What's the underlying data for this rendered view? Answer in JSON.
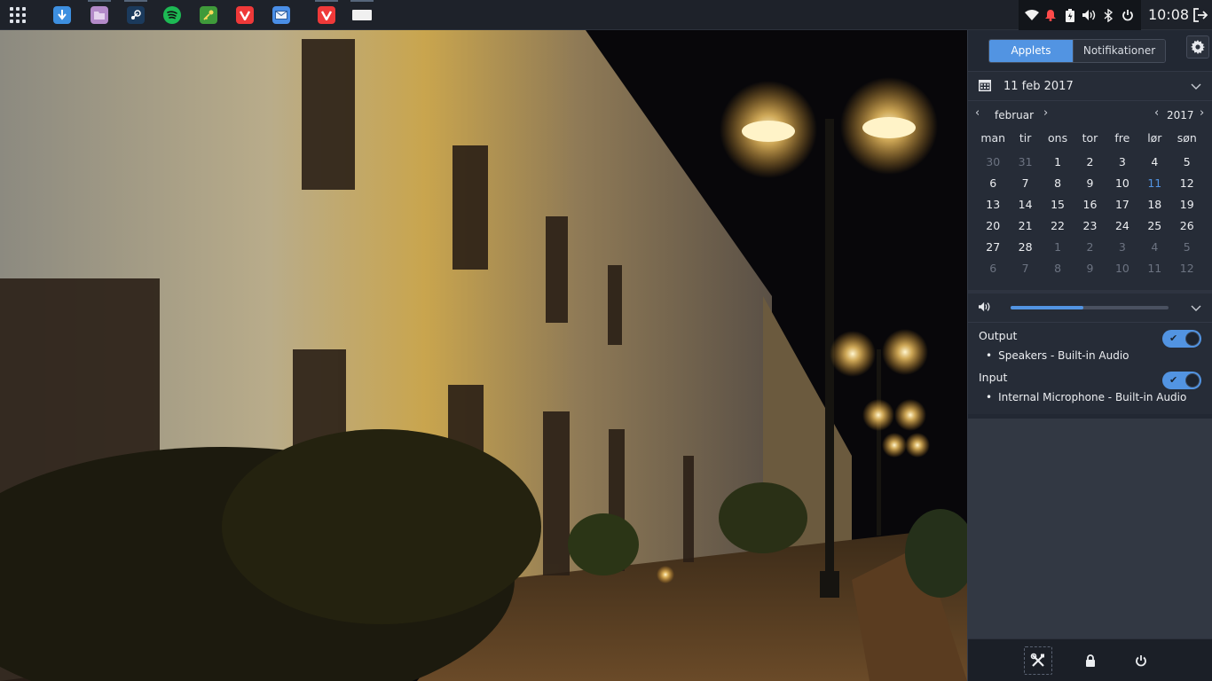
{
  "taskbar": {
    "launcher_icon": "app-grid-icon",
    "tasks": [
      {
        "name": "downloader",
        "icon": "download-arrow-icon",
        "color": "#3d8fe0"
      },
      {
        "name": "file-manager",
        "icon": "folder-icon",
        "color": "#b38ac9"
      },
      {
        "name": "steam",
        "icon": "steam-icon",
        "color": "#1b3a5c"
      },
      {
        "name": "spotify",
        "icon": "spotify-icon",
        "color": "#1db954"
      },
      {
        "name": "password-manager",
        "icon": "key-icon",
        "color": "#3f9a3a"
      },
      {
        "name": "vivaldi",
        "icon": "vivaldi-icon",
        "color": "#ef3939"
      },
      {
        "name": "mail",
        "icon": "envelope-icon",
        "color": "#4a8ee6"
      },
      {
        "name": "vivaldi-window",
        "icon": "vivaldi-icon",
        "color": "#ef3939"
      },
      {
        "name": "blank-window",
        "icon": "window-icon",
        "color": "#f0f0f0"
      }
    ],
    "tray_icons": [
      "wifi-icon",
      "notification-bell-icon",
      "battery-icon",
      "volume-icon",
      "bluetooth-icon",
      "power-icon"
    ],
    "clock": "10:08",
    "logout_icon": "logout-icon"
  },
  "raven": {
    "tabs": {
      "applets": "Applets",
      "notifications": "Notifikationer"
    },
    "settings_icon": "gear-icon",
    "calendar": {
      "header_date": "11 feb 2017",
      "month": "februar",
      "year": "2017",
      "prev": "‹",
      "next": "›",
      "weekdays": [
        "man",
        "tir",
        "ons",
        "tor",
        "fre",
        "lør",
        "søn"
      ],
      "weeks": [
        [
          {
            "d": "30",
            "m": "prev"
          },
          {
            "d": "31",
            "m": "prev"
          },
          {
            "d": "1",
            "m": "cur"
          },
          {
            "d": "2",
            "m": "cur"
          },
          {
            "d": "3",
            "m": "cur"
          },
          {
            "d": "4",
            "m": "cur"
          },
          {
            "d": "5",
            "m": "cur"
          }
        ],
        [
          {
            "d": "6",
            "m": "cur"
          },
          {
            "d": "7",
            "m": "cur"
          },
          {
            "d": "8",
            "m": "cur"
          },
          {
            "d": "9",
            "m": "cur"
          },
          {
            "d": "10",
            "m": "cur"
          },
          {
            "d": "11",
            "m": "today"
          },
          {
            "d": "12",
            "m": "cur"
          }
        ],
        [
          {
            "d": "13",
            "m": "cur"
          },
          {
            "d": "14",
            "m": "cur"
          },
          {
            "d": "15",
            "m": "cur"
          },
          {
            "d": "16",
            "m": "cur"
          },
          {
            "d": "17",
            "m": "cur"
          },
          {
            "d": "18",
            "m": "cur"
          },
          {
            "d": "19",
            "m": "cur"
          }
        ],
        [
          {
            "d": "20",
            "m": "cur"
          },
          {
            "d": "21",
            "m": "cur"
          },
          {
            "d": "22",
            "m": "cur"
          },
          {
            "d": "23",
            "m": "cur"
          },
          {
            "d": "24",
            "m": "cur"
          },
          {
            "d": "25",
            "m": "cur"
          },
          {
            "d": "26",
            "m": "cur"
          }
        ],
        [
          {
            "d": "27",
            "m": "cur"
          },
          {
            "d": "28",
            "m": "cur"
          },
          {
            "d": "1",
            "m": "next"
          },
          {
            "d": "2",
            "m": "next"
          },
          {
            "d": "3",
            "m": "next"
          },
          {
            "d": "4",
            "m": "next"
          },
          {
            "d": "5",
            "m": "next"
          }
        ],
        [
          {
            "d": "6",
            "m": "next"
          },
          {
            "d": "7",
            "m": "next"
          },
          {
            "d": "8",
            "m": "next"
          },
          {
            "d": "9",
            "m": "next"
          },
          {
            "d": "10",
            "m": "next"
          },
          {
            "d": "11",
            "m": "next"
          },
          {
            "d": "12",
            "m": "next"
          }
        ]
      ]
    },
    "sound": {
      "volume_fraction": 0.46,
      "output_label": "Output",
      "output_device": "Speakers - Built-in Audio",
      "output_enabled": true,
      "input_label": "Input",
      "input_device": "Internal Microphone - Built-in Audio",
      "input_enabled": true
    },
    "footer_icons": [
      "settings-tools-icon",
      "lock-icon",
      "power-icon"
    ]
  },
  "colors": {
    "accent": "#5294e2",
    "panel": "#1e222a",
    "sidebar": "#222833"
  }
}
